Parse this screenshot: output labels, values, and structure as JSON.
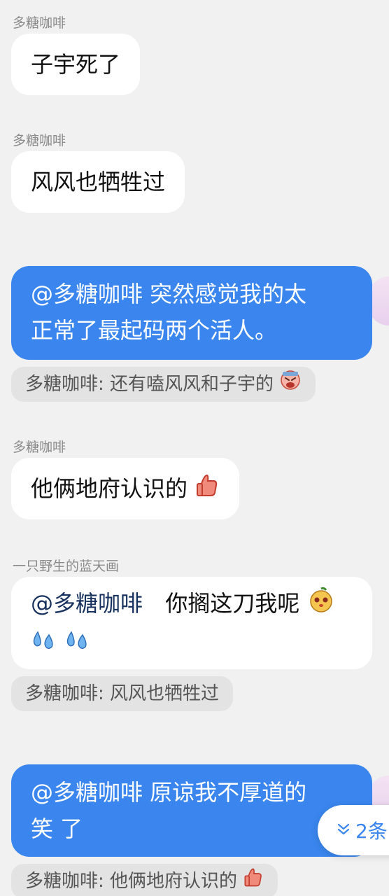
{
  "messages": [
    {
      "sender": "多糖咖啡",
      "text": "子宇死了"
    },
    {
      "sender": "多糖咖啡",
      "text": "风风也牺牲过"
    },
    {
      "self_line1": "@多糖咖啡  突然感觉我的太",
      "self_line2": "正常了最起码两个活人。",
      "quote": "多糖咖啡: 还有嗑风风和子宇的"
    },
    {
      "sender": "多糖咖啡",
      "text": "他俩地府认识的"
    },
    {
      "sender": "一只野生的蓝天画",
      "mention": "@多糖咖啡",
      "text": "你搁这刀我呢",
      "quote": "多糖咖啡: 风风也牺牲过"
    },
    {
      "self_line1": "@多糖咖啡  原谅我不厚道的",
      "self_line2": "笑 了",
      "quote": "多糖咖啡: 他俩地府认识的"
    }
  ],
  "new_messages_badge": "2条",
  "icons": {
    "thumbs_up": "thumbs-up-emoji",
    "crying": "crying-face-emoji",
    "mango": "mango-face-emoji",
    "sweat": "sweat-drops-emoji",
    "chevron": "double-chevron-down-icon"
  },
  "colors": {
    "self_bubble": "#3a86ee",
    "other_bubble": "#ffffff",
    "background": "#f1f1f1",
    "quote_bg": "#e3e3e3"
  }
}
